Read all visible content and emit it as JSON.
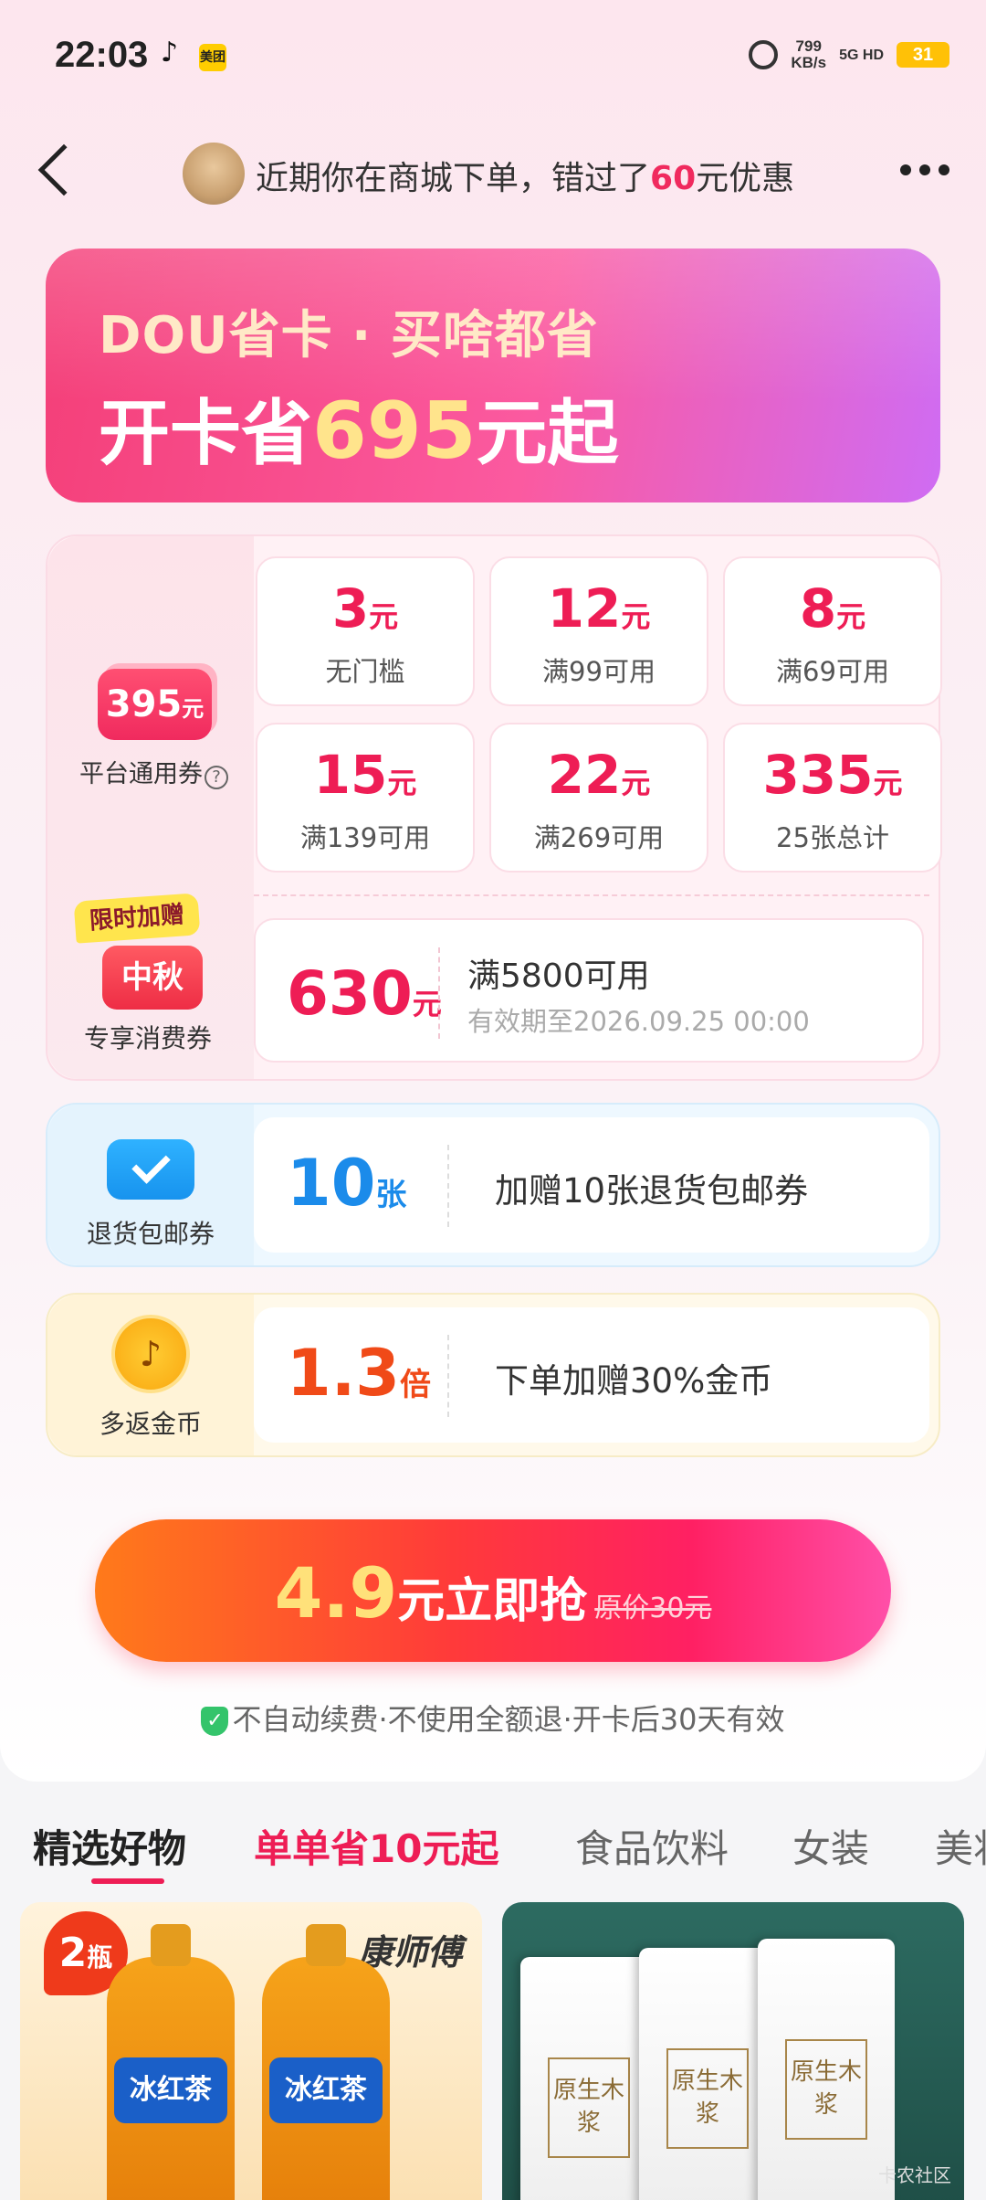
{
  "status_bar": {
    "time": "22:03",
    "app_icon_1": "tiktok-icon",
    "app_icon_2": "美团",
    "speed_value": "799",
    "speed_unit": "KB/s",
    "network": "5G HD",
    "battery": "31"
  },
  "header": {
    "message_prefix": "近期你在商城下单，错过了",
    "message_amount": "60",
    "message_suffix": "元优惠"
  },
  "banner": {
    "subtitle": "DOU省卡 · 买啥都省",
    "title_prefix": "开卡省",
    "title_amount": "695",
    "title_suffix": "元起"
  },
  "platform_coupons": {
    "total_amount": "395",
    "total_unit": "元",
    "label": "平台通用券",
    "help": "?",
    "coupons": [
      {
        "amount": "3",
        "unit": "元",
        "condition": "无门槛"
      },
      {
        "amount": "12",
        "unit": "元",
        "condition": "满99可用"
      },
      {
        "amount": "8",
        "unit": "元",
        "condition": "满69可用"
      },
      {
        "amount": "15",
        "unit": "元",
        "condition": "满139可用"
      },
      {
        "amount": "22",
        "unit": "元",
        "condition": "满269可用"
      },
      {
        "amount": "335",
        "unit": "元",
        "condition": "25张总计"
      }
    ]
  },
  "exclusive_coupon": {
    "limit_tag": "限时加赠",
    "badge": "中秋",
    "label": "专享消费券",
    "amount": "630",
    "unit": "元",
    "condition": "满5800可用",
    "validity": "有效期至2026.09.25 00:00"
  },
  "return_shipping": {
    "label": "退货包邮券",
    "amount": "10",
    "unit": "张",
    "description": "加赠10张退货包邮券"
  },
  "coins": {
    "label": "多返金币",
    "amount": "1.3",
    "unit": "倍",
    "description": "下单加赠30%金币"
  },
  "cta": {
    "price": "4.9",
    "label": "元立即抢",
    "original_price": "原价30元"
  },
  "note": "不自动续费·不使用全额退·开卡后30天有效",
  "tabs": [
    {
      "label": "精选好物"
    },
    {
      "label": "单单省10元起"
    },
    {
      "label": "食品饮料"
    },
    {
      "label": "女装"
    },
    {
      "label": "美妆"
    }
  ],
  "products": [
    {
      "tag_num": "2",
      "tag_unit": "瓶",
      "brand": "康师傅",
      "bottle_label": "冰红茶"
    },
    {
      "tissue_label": "原生木浆"
    }
  ],
  "watermark": "卡农社区",
  "colors": {
    "accent": "#ee1d55",
    "blue": "#1b8bea",
    "orange": "#f04a18"
  }
}
